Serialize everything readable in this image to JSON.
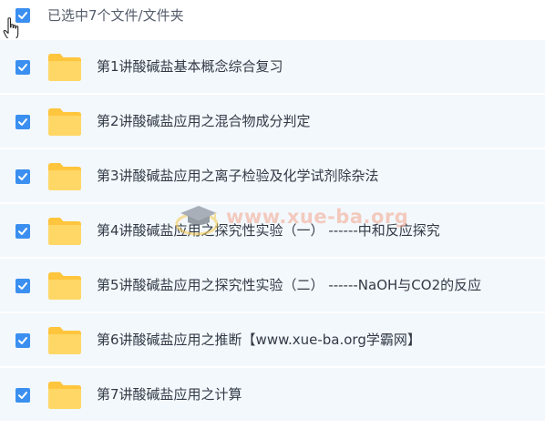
{
  "header": {
    "selection_text": "已选中7个文件/文件夹"
  },
  "files": [
    {
      "name": "第1讲酸碱盐基本概念综合复习",
      "checked": true,
      "icon": "folder-icon"
    },
    {
      "name": "第2讲酸碱盐应用之混合物成分判定",
      "checked": true,
      "icon": "folder-icon"
    },
    {
      "name": "第3讲酸碱盐应用之离子检验及化学试剂除杂法",
      "checked": true,
      "icon": "folder-icon"
    },
    {
      "name": "第4讲酸碱盐应用之探究性实验（一） ------中和反应探究",
      "checked": true,
      "icon": "folder-icon"
    },
    {
      "name": "第5讲酸碱盐应用之探究性实验（二） ------NaOH与CO2的反应",
      "checked": true,
      "icon": "folder-icon"
    },
    {
      "name": "第6讲酸碱盐应用之推断【www.xue-ba.org学霸网】",
      "checked": true,
      "icon": "folder-icon"
    },
    {
      "name": "第7讲酸碱盐应用之计算",
      "checked": true,
      "icon": "folder-icon"
    }
  ],
  "watermark": {
    "text": "www.xue-ba.org"
  },
  "colors": {
    "checkbox": "#3b8ff0",
    "folder": "#ffc53d",
    "row_bg": "#f3f8fd"
  }
}
